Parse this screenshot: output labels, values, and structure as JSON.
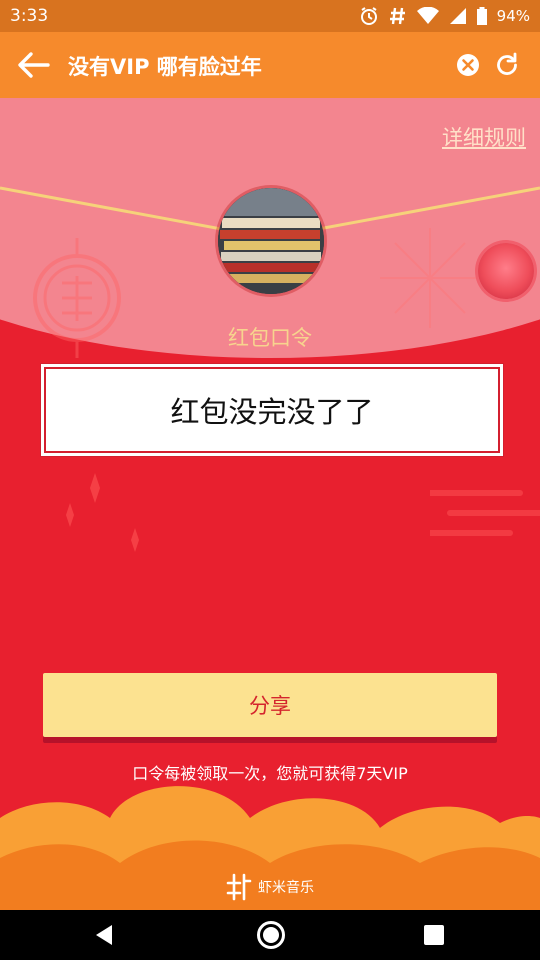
{
  "status_bar": {
    "time": "3:33",
    "battery": "94%",
    "icons": [
      "alarm-icon",
      "hash-icon",
      "wifi-icon",
      "signal-icon",
      "battery-icon"
    ]
  },
  "app_bar": {
    "title": "没有VIP 哪有脸过年",
    "icons": [
      "back-arrow-icon",
      "close-circle-icon",
      "refresh-icon"
    ]
  },
  "page": {
    "rules_link": "详细规则",
    "token_label": "红包口令",
    "token_text": "红包没完没了了",
    "share_button": "分享",
    "hint": "口令每被领取一次，您就可获得7天VIP",
    "brand": "虾米音乐"
  },
  "colors": {
    "status_bar": "#d8731f",
    "app_bar": "#f68a2c",
    "envelope_red": "#e8202f",
    "flap_pink": "#f3858f",
    "share_button": "#fce290",
    "share_text": "#d4252d",
    "token_label": "#f7d48e"
  },
  "nav_bar": {
    "icons": [
      "back-triangle-icon",
      "home-circle-icon",
      "recents-square-icon"
    ]
  }
}
